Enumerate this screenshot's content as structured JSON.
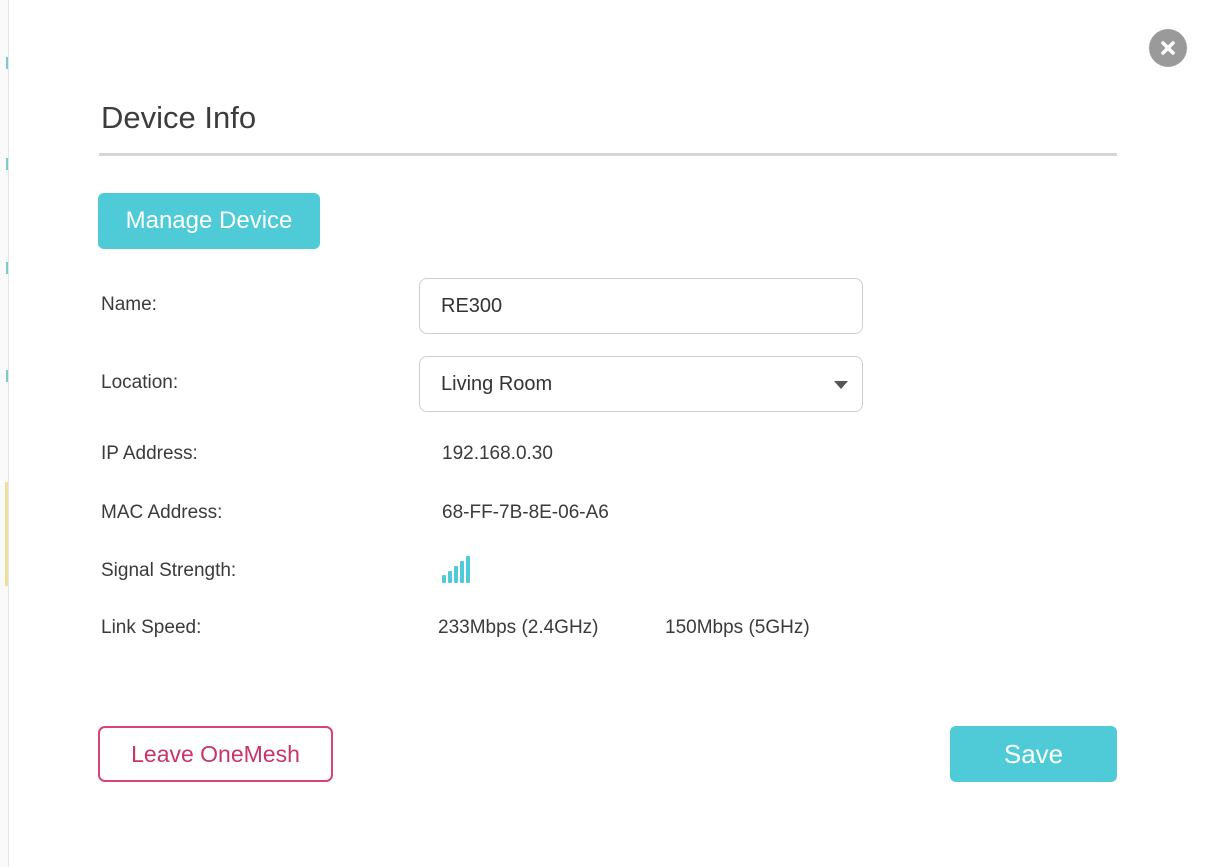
{
  "dialog": {
    "title": "Device Info",
    "manage_button": "Manage Device",
    "close_icon": "close-icon"
  },
  "fields": {
    "name_label": "Name:",
    "name_value": "RE300",
    "location_label": "Location:",
    "location_value": "Living Room",
    "ip_label": "IP Address:",
    "ip_value": "192.168.0.30",
    "mac_label": "MAC Address:",
    "mac_value": "68-FF-7B-8E-06-A6",
    "signal_label": "Signal Strength:",
    "signal_icon": "signal-strength-icon",
    "signal_bars": 5,
    "signal_bars_total": 5,
    "speed_label": "Link Speed:",
    "speed_24": "233Mbps (2.4GHz)",
    "speed_5": "150Mbps (5GHz)"
  },
  "actions": {
    "leave_label": "Leave OneMesh",
    "save_label": "Save"
  },
  "colors": {
    "accent": "#4ecbd6",
    "danger": "#d8427a",
    "close_bg": "#9a9a9a"
  }
}
